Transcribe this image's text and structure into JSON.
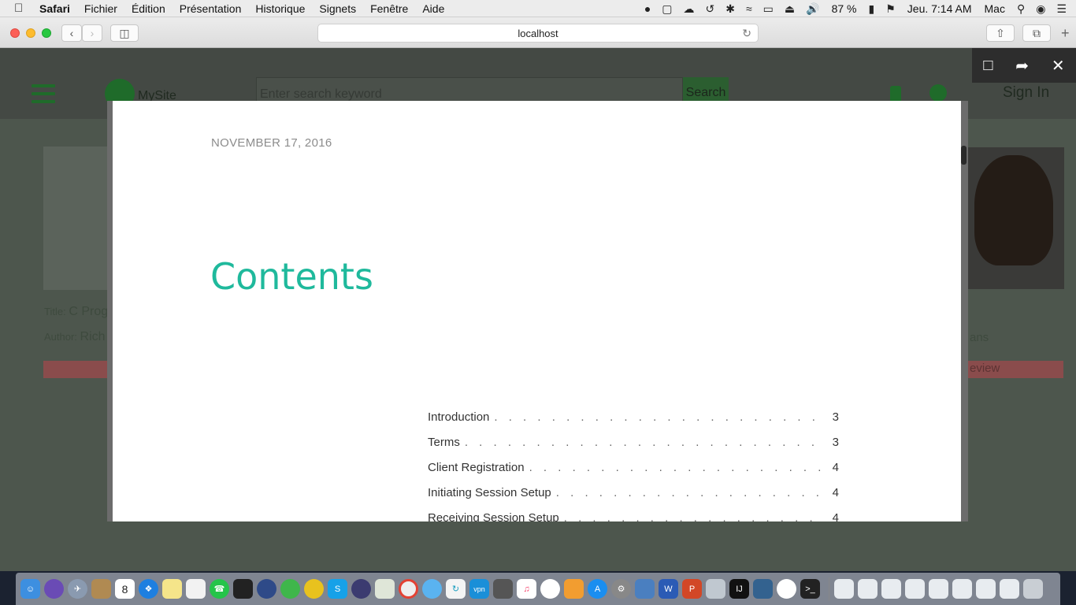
{
  "menubar": {
    "app_name": "Safari",
    "items": [
      "Fichier",
      "Édition",
      "Présentation",
      "Historique",
      "Signets",
      "Fenêtre",
      "Aide"
    ],
    "battery": "87 %",
    "clock": "Jeu. 7:14 AM",
    "user": "Mac"
  },
  "browser": {
    "address": "localhost"
  },
  "site": {
    "logo_text": "MySite",
    "search_placeholder": "Enter search keyword",
    "search_button": "Search",
    "sign_in": "Sign In",
    "card_title_prefix": "Title: ",
    "card_title": "C Prog",
    "card_author_prefix": "Author: ",
    "card_author": "Rich",
    "card_right_partial": "ans",
    "review_button": "eview"
  },
  "document": {
    "date": "NOVEMBER 17, 2016",
    "title": "Contents",
    "toc": [
      {
        "label": "Introduction",
        "page": "3"
      },
      {
        "label": "Terms",
        "page": "3"
      },
      {
        "label": "Client Registration",
        "page": "4"
      },
      {
        "label": "Initiating Session Setup",
        "page": "4"
      },
      {
        "label": "Receiving Session Setup",
        "page": "4"
      }
    ]
  },
  "dock": {
    "calendar_day": "8"
  }
}
